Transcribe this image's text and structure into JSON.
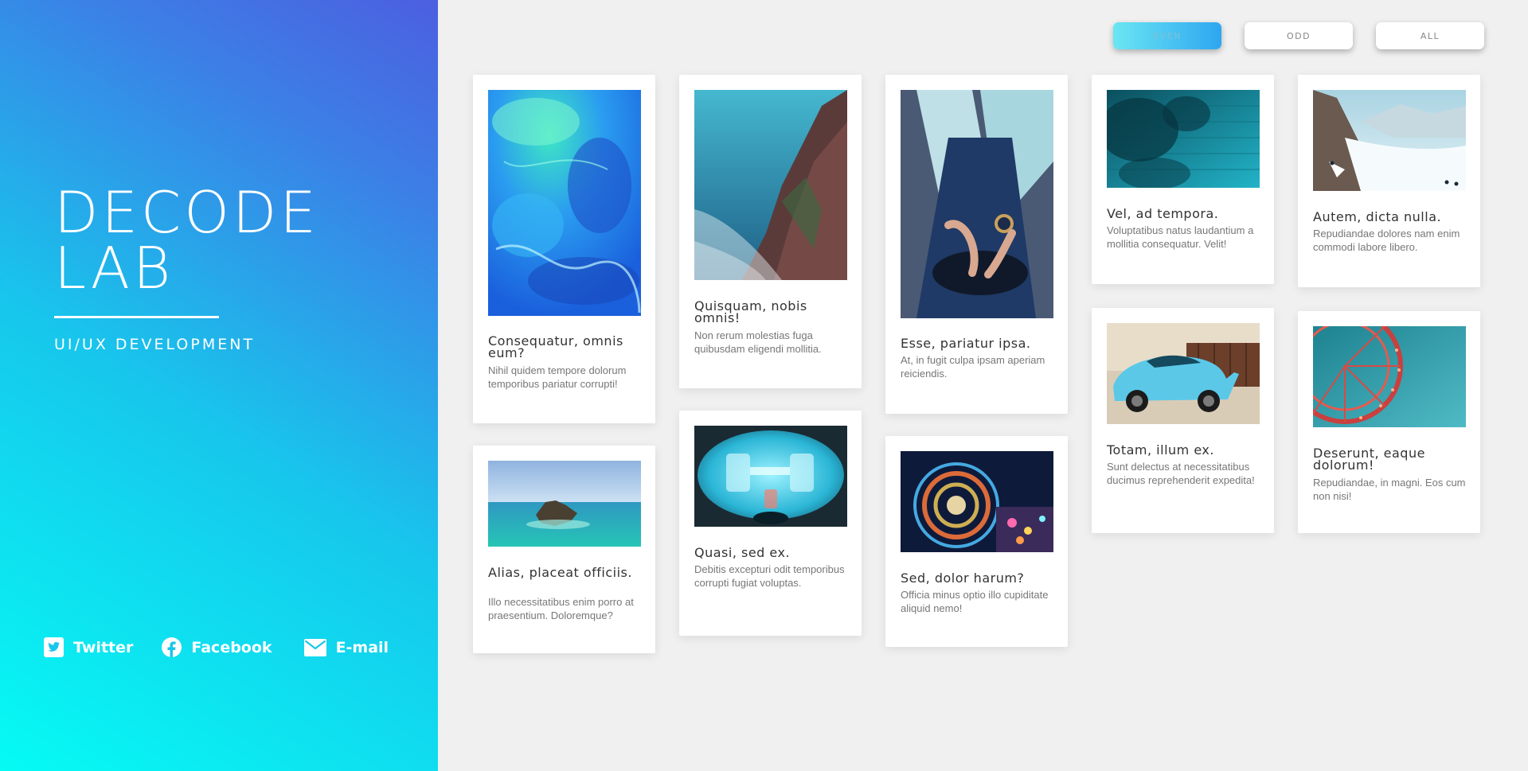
{
  "sidebar": {
    "brand_line1": "DECODE",
    "brand_line2": "LAB",
    "tagline": "UI/UX DEVELOPMENT",
    "socials": [
      {
        "label": "Twitter",
        "icon": "twitter-icon"
      },
      {
        "label": "Facebook",
        "icon": "facebook-icon"
      },
      {
        "label": "E-mail",
        "icon": "mail-icon"
      }
    ],
    "gradient": [
      "#05fbf4",
      "#17c7ec",
      "#3c7fe6",
      "#4c5fe0"
    ]
  },
  "filters": [
    {
      "label": "EVEN",
      "active": true
    },
    {
      "label": "ODD",
      "active": false
    },
    {
      "label": "ALL",
      "active": false
    }
  ],
  "cards": [
    {
      "title": "Consequatur, omnis eum?",
      "desc": "Nihil quidem tempore dolorum temporibus pariatur corrupti!",
      "image": "blue abstract marbled paint"
    },
    {
      "title": "Alias, placeat officiis.",
      "desc": "Illo necessitatibus enim porro at praesentium. Doloremque?",
      "image": "small rocky island in turquoise sea"
    },
    {
      "title": "Quisquam, nobis omnis!",
      "desc": "Non rerum molestias fuga quibusdam eligendi mollitia.",
      "image": "ocean cliffs and waves"
    },
    {
      "title": "Quasi, sed ex.",
      "desc": "Debitis excepturi odit temporibus corrupti fugiat voluptas.",
      "image": "laboratory machine with blue light"
    },
    {
      "title": "Esse, pariatur ipsa.",
      "desc": "At, in fugit culpa ipsam aperiam reiciendis.",
      "image": "man tying shoe wearing watch"
    },
    {
      "title": "Sed, dolor harum?",
      "desc": "Officia minus optio illo cupiditate aliquid nemo!",
      "image": "ferris wheel long exposure at night"
    },
    {
      "title": "Vel, ad tempora.",
      "desc": "Voluptatibus natus laudantium a mollitia consequatur. Velit!",
      "image": "teal brick wall with leaf shadows"
    },
    {
      "title": "Totam, illum ex.",
      "desc": "Sunt delectus at necessitatibus ducimus reprehenderit expedita!",
      "image": "light blue sports car"
    },
    {
      "title": "Autem, dicta nulla.",
      "desc": "Repudiandae dolores nam enim commodi labore libero.",
      "image": "snowy mountain slope with skiers"
    },
    {
      "title": "Deserunt, eaque dolorum!",
      "desc": "Repudiandae, in magni. Eos cum non nisi!",
      "image": "ferris wheel against teal sky"
    }
  ],
  "colors": {
    "page_bg": "#f0f0f0",
    "card_bg": "#ffffff",
    "title_text": "#333333",
    "desc_text": "#777777",
    "active_filter": [
      "#6ae6f2",
      "#2ea6f1"
    ]
  }
}
